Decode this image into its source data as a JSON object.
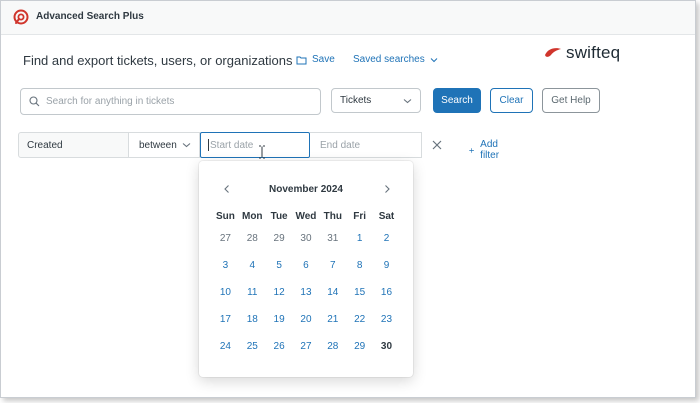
{
  "app": {
    "title": "Advanced Search Plus"
  },
  "header": {
    "headline": "Find and export tickets, users, or organizations",
    "save_label": "Save",
    "saved_searches_label": "Saved searches",
    "brand_name": "swifteq"
  },
  "search": {
    "placeholder": "Search for anything in tickets",
    "value": "",
    "type_selected": "Tickets",
    "search_button": "Search",
    "clear_button": "Clear",
    "help_button": "Get Help"
  },
  "filter": {
    "field": "Created",
    "operator": "between",
    "start_placeholder": "Start date",
    "end_placeholder": "End date",
    "add_filter_label": "Add filter"
  },
  "calendar": {
    "month_label": "November 2024",
    "weekdays": [
      "Sun",
      "Mon",
      "Tue",
      "Wed",
      "Thu",
      "Fri",
      "Sat"
    ],
    "days": [
      {
        "label": "27",
        "type": "prev"
      },
      {
        "label": "28",
        "type": "prev"
      },
      {
        "label": "29",
        "type": "prev"
      },
      {
        "label": "30",
        "type": "prev"
      },
      {
        "label": "31",
        "type": "prev"
      },
      {
        "label": "1",
        "type": "cur"
      },
      {
        "label": "2",
        "type": "cur"
      },
      {
        "label": "3",
        "type": "cur"
      },
      {
        "label": "4",
        "type": "cur"
      },
      {
        "label": "5",
        "type": "cur"
      },
      {
        "label": "6",
        "type": "cur"
      },
      {
        "label": "7",
        "type": "cur"
      },
      {
        "label": "8",
        "type": "cur"
      },
      {
        "label": "9",
        "type": "cur"
      },
      {
        "label": "10",
        "type": "cur"
      },
      {
        "label": "11",
        "type": "cur"
      },
      {
        "label": "12",
        "type": "cur"
      },
      {
        "label": "13",
        "type": "cur"
      },
      {
        "label": "14",
        "type": "cur"
      },
      {
        "label": "15",
        "type": "cur"
      },
      {
        "label": "16",
        "type": "cur"
      },
      {
        "label": "17",
        "type": "cur"
      },
      {
        "label": "18",
        "type": "cur"
      },
      {
        "label": "19",
        "type": "cur"
      },
      {
        "label": "20",
        "type": "cur"
      },
      {
        "label": "21",
        "type": "cur"
      },
      {
        "label": "22",
        "type": "cur"
      },
      {
        "label": "23",
        "type": "cur"
      },
      {
        "label": "24",
        "type": "cur"
      },
      {
        "label": "25",
        "type": "cur"
      },
      {
        "label": "26",
        "type": "cur"
      },
      {
        "label": "27",
        "type": "cur"
      },
      {
        "label": "28",
        "type": "cur"
      },
      {
        "label": "29",
        "type": "cur"
      },
      {
        "label": "30",
        "type": "today"
      }
    ]
  },
  "colors": {
    "accent": "#1f73b7",
    "brand_red": "#d0352c",
    "text": "#2f3941",
    "muted": "#68737d"
  },
  "icons": {
    "app_logo": "app-logo-icon",
    "save": "folder-icon",
    "saved_searches_caret": "chevron-down-icon",
    "search": "search-icon",
    "select_caret": "chevron-down-icon",
    "remove_filter": "close-icon",
    "add_filter": "plus-icon",
    "prev_month": "chevron-left-icon",
    "next_month": "chevron-right-icon",
    "cursor": "text-cursor-icon"
  }
}
